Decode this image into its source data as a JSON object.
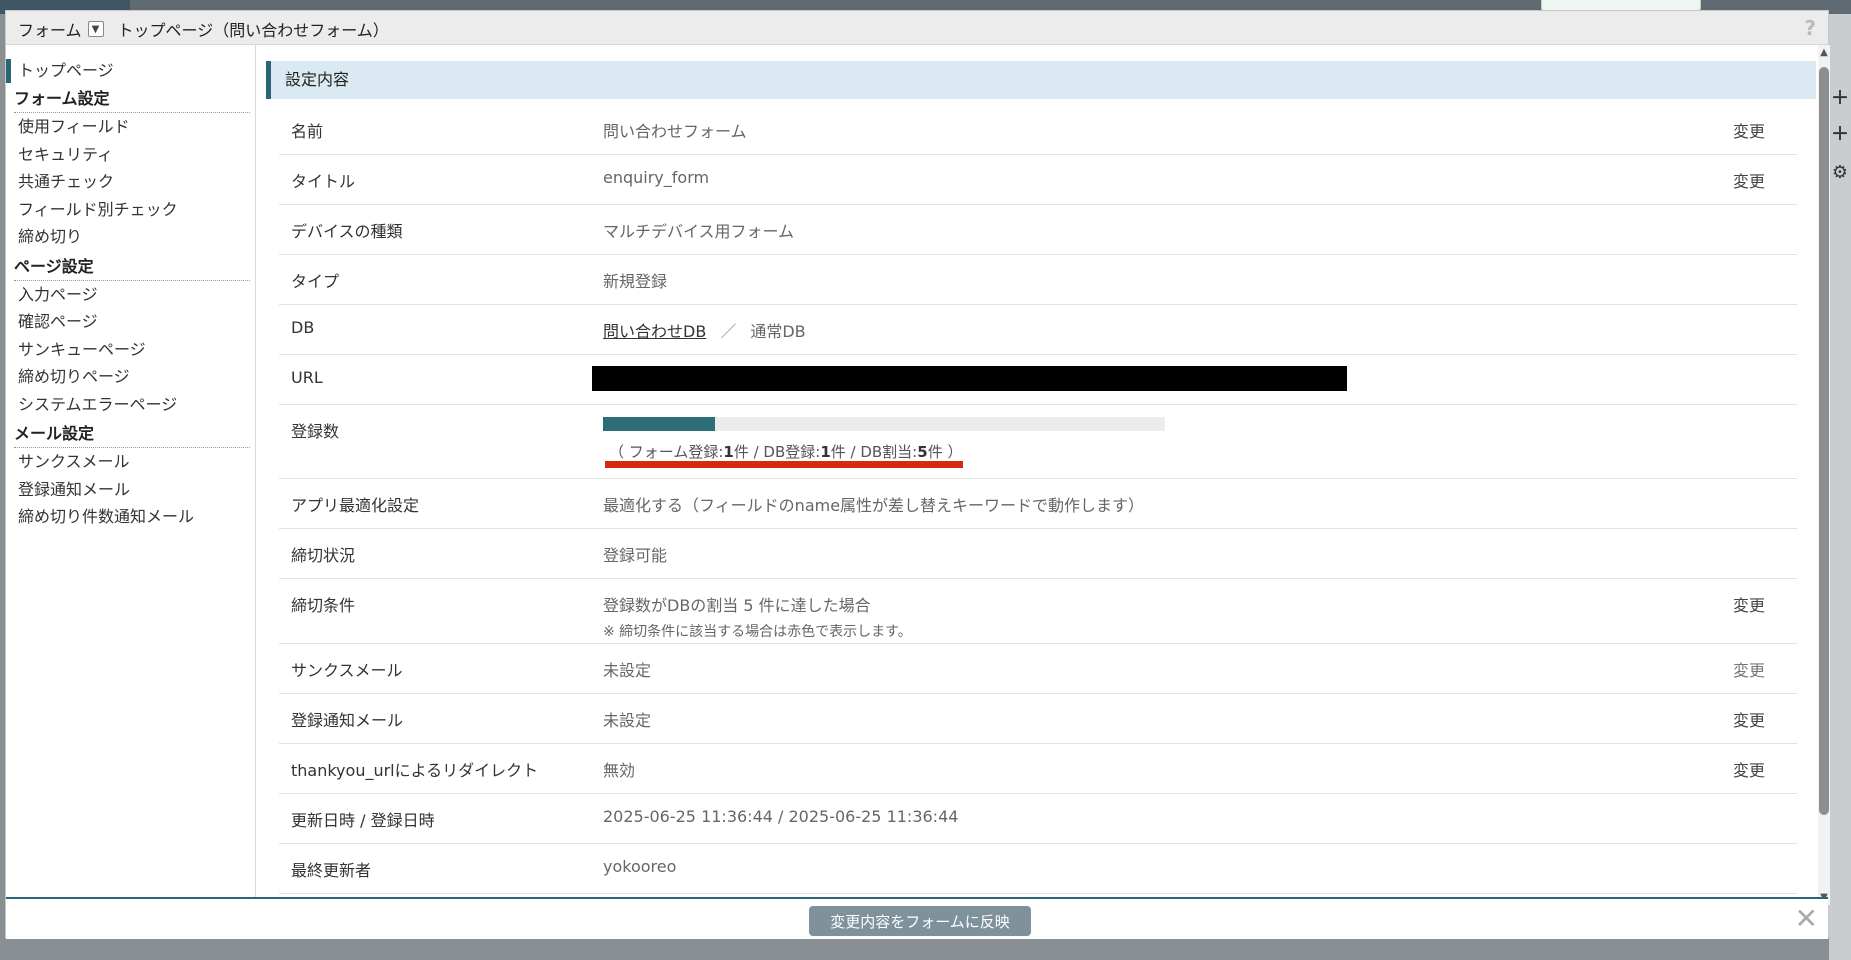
{
  "header": {
    "crumb_root": "フォーム",
    "crumb_page": "トップページ（問い合わせフォーム）",
    "help": "?"
  },
  "sidebar": {
    "top_item": "トップページ",
    "groups": [
      {
        "heading": "フォーム設定",
        "items": [
          "使用フィールド",
          "セキュリティ",
          "共通チェック",
          "フィールド別チェック",
          "締め切り"
        ]
      },
      {
        "heading": "ページ設定",
        "items": [
          "入力ページ",
          "確認ページ",
          "サンキューページ",
          "締め切りページ",
          "システムエラーページ"
        ]
      },
      {
        "heading": "メール設定",
        "items": [
          "サンクスメール",
          "登録通知メール",
          "締め切り件数通知メール"
        ]
      }
    ]
  },
  "main": {
    "section_title": "設定内容",
    "change_label": "変更",
    "rows": {
      "name": {
        "label": "名前",
        "value": "問い合わせフォーム"
      },
      "title": {
        "label": "タイトル",
        "value": "enquiry_form"
      },
      "device": {
        "label": "デバイスの種類",
        "value": "マルチデバイス用フォーム"
      },
      "type": {
        "label": "タイプ",
        "value": "新規登録"
      },
      "db": {
        "label": "DB",
        "link": "問い合わせDB",
        "sep": "／",
        "kind": "通常DB"
      },
      "url": {
        "label": "URL"
      },
      "count": {
        "label": "登録数",
        "progress": 0.2,
        "open": "（ フォーム登録:",
        "form_count": "1",
        "mid1": "件 / DB登録:",
        "db_count": "1",
        "mid2": "件 / DB割当:",
        "quota": "5",
        "close": "件 ）"
      },
      "app_opt": {
        "label": "アプリ最適化設定",
        "value": "最適化する（フィールドのname属性が差し替えキーワードで動作します）"
      },
      "deadline_status": {
        "label": "締切状況",
        "value": "登録可能"
      },
      "deadline_cond": {
        "label": "締切条件",
        "value": "登録数がDBの割当 5 件に達した場合",
        "note": "※ 締切条件に該当する場合は赤色で表示します。"
      },
      "thanks_mail": {
        "label": "サンクスメール",
        "value": "未設定"
      },
      "notify_mail": {
        "label": "登録通知メール",
        "value": "未設定"
      },
      "redirect": {
        "label": "thankyou_urlによるリダイレクト",
        "value": "無効"
      },
      "updated": {
        "label": "更新日時 / 登録日時",
        "value": "2025-06-25 11:36:44 / 2025-06-25 11:36:44"
      },
      "last_editor": {
        "label": "最終更新者",
        "value": "yokooreo"
      }
    }
  },
  "footer": {
    "apply_label": "変更内容をフォームに反映",
    "close": "✕"
  },
  "colors": {
    "accent": "#2a6678",
    "progress": "#2d6d77",
    "highlight": "#d42a10",
    "button": "#7f929b"
  }
}
